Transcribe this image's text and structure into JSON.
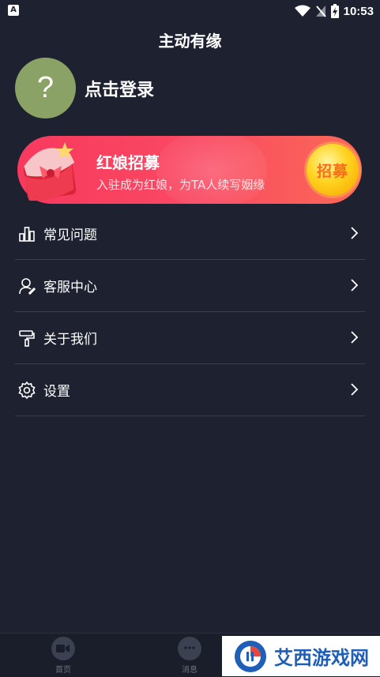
{
  "status_bar": {
    "app_badge": "A",
    "time": "10:53"
  },
  "header": {
    "title": "主动有缘"
  },
  "profile": {
    "avatar_glyph": "?",
    "login_label": "点击登录"
  },
  "banner": {
    "title": "红娘招募",
    "subtitle": "入驻成为红娘，为TA人续写姻缘",
    "button_label": "招募"
  },
  "menu": {
    "items": [
      {
        "label": "常见问题",
        "icon": "bar-chart-icon"
      },
      {
        "label": "客服中心",
        "icon": "user-service-icon"
      },
      {
        "label": "关于我们",
        "icon": "paint-roller-icon"
      },
      {
        "label": "设置",
        "icon": "gear-icon"
      }
    ]
  },
  "tabbar": {
    "tabs": [
      {
        "label": "首页",
        "icon": "video-icon"
      },
      {
        "label": "消息",
        "icon": "chat-icon"
      }
    ]
  },
  "watermark": {
    "text": "艾西游戏网"
  },
  "colors": {
    "background": "#1e2230",
    "avatar": "#8aa265",
    "banner_start": "#f8395e",
    "banner_end": "#fb6a55",
    "button_gold": "#ffd21d",
    "divider": "#3a3f4e"
  }
}
